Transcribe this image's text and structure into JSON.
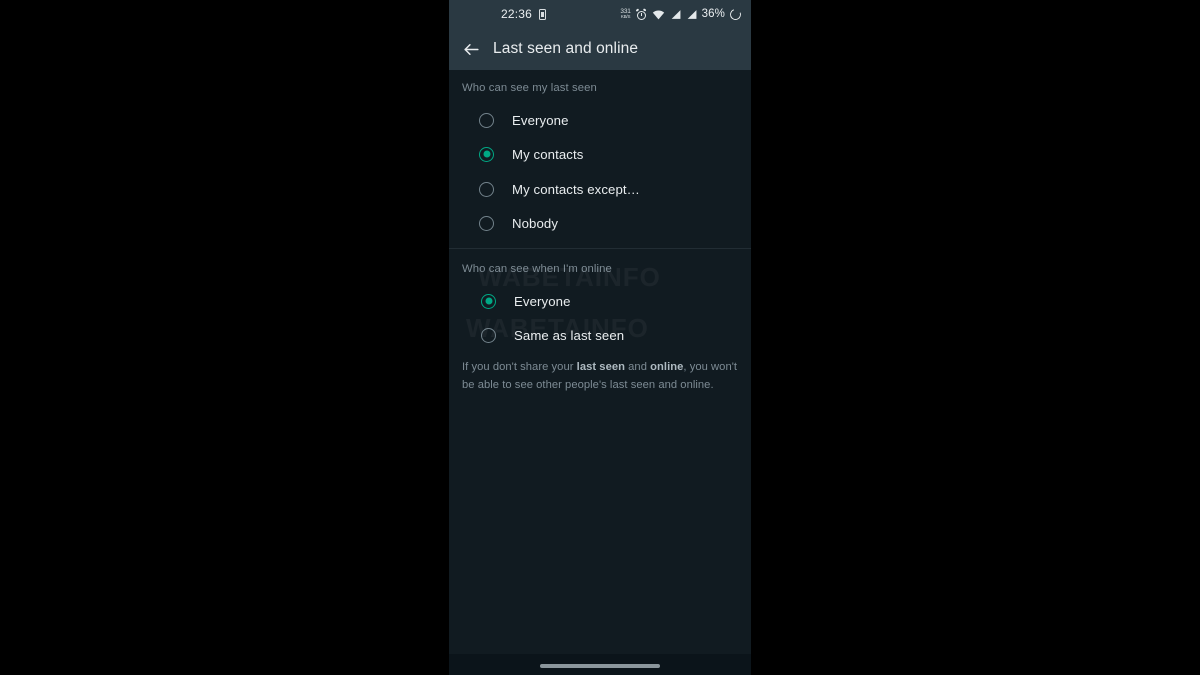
{
  "status_bar": {
    "time": "22:36",
    "sim_icon": "sim-card-icon",
    "data_rate_top": "331",
    "data_rate_bottom": "KB/S",
    "alarm_icon": "alarm-clock-icon",
    "wifi_icon": "wifi-icon",
    "signal_icon_1": "cellular-signal-icon",
    "signal_icon_2": "cellular-signal-icon",
    "battery_percent": "36%",
    "battery_icon": "battery-ring-icon"
  },
  "app_bar": {
    "back_icon": "back-arrow-icon",
    "title": "Last seen and online"
  },
  "sections": [
    {
      "header": "Who can see my last seen",
      "options": [
        {
          "label": "Everyone",
          "selected": false
        },
        {
          "label": "My contacts",
          "selected": true
        },
        {
          "label": "My contacts except…",
          "selected": false
        },
        {
          "label": "Nobody",
          "selected": false
        }
      ]
    },
    {
      "header": "Who can see when I'm online",
      "options": [
        {
          "label": "Everyone",
          "selected": true
        },
        {
          "label": "Same as last seen",
          "selected": false
        }
      ]
    }
  ],
  "footnote": {
    "part1": "If you don't share your ",
    "bold1": "last seen",
    "part2": " and ",
    "bold2": "online",
    "part3": ", you won't be able to see other people's last seen and online."
  },
  "watermark": {
    "text": "WABETAINFO"
  },
  "nav_bar": {
    "gesture_pill": "gesture-navigation-pill"
  },
  "colors": {
    "accent": "#00a884",
    "app_bar_bg": "#2a3942",
    "body_bg": "#111b21",
    "nav_bg": "#0b141a",
    "primary_text": "#e9edef",
    "secondary_text": "#7d8b94",
    "letterbox": "#000000"
  }
}
